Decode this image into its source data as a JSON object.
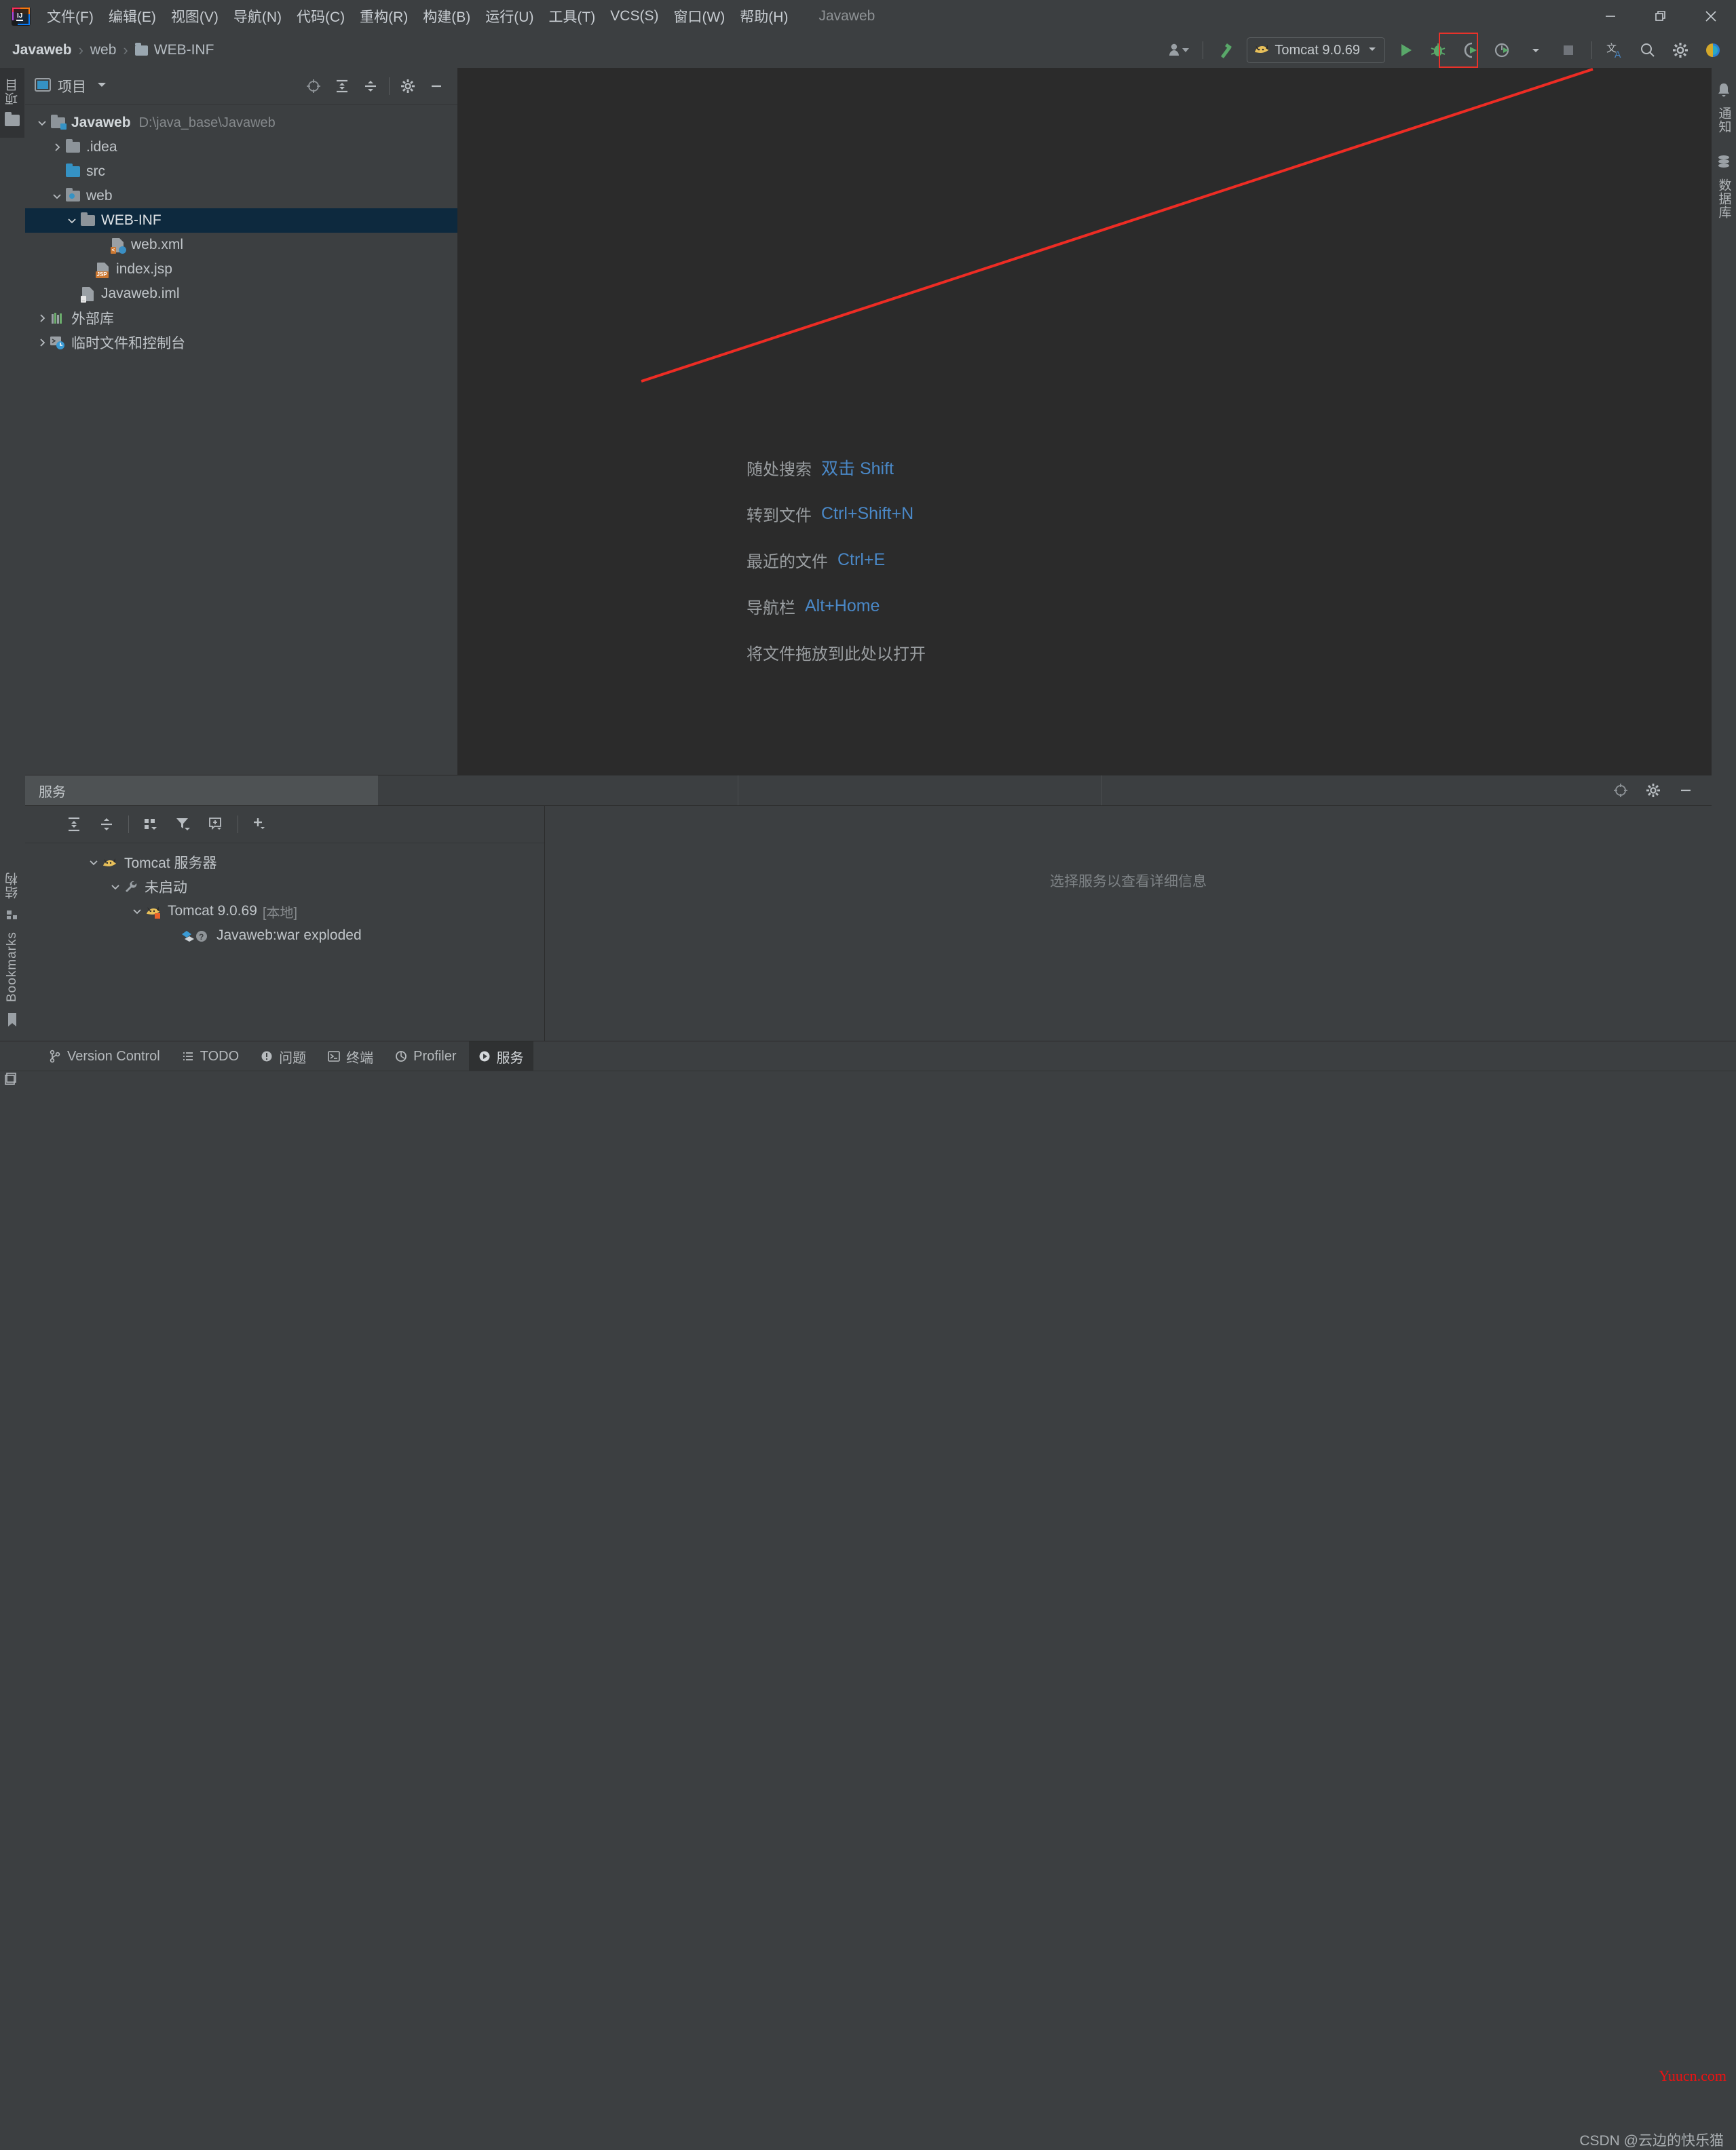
{
  "window": {
    "title": "Javaweb",
    "controls": {
      "minimize": "minimize-icon",
      "restore": "restore-icon",
      "close": "close-icon"
    }
  },
  "menubar": {
    "logo": "intellij-idea-logo",
    "items": [
      {
        "label": "文件(F)",
        "mnemonic": "F"
      },
      {
        "label": "编辑(E)",
        "mnemonic": "E"
      },
      {
        "label": "视图(V)",
        "mnemonic": "V"
      },
      {
        "label": "导航(N)",
        "mnemonic": "N"
      },
      {
        "label": "代码(C)",
        "mnemonic": "C"
      },
      {
        "label": "重构(R)",
        "mnemonic": "R"
      },
      {
        "label": "构建(B)",
        "mnemonic": "B"
      },
      {
        "label": "运行(U)",
        "mnemonic": "U"
      },
      {
        "label": "工具(T)",
        "mnemonic": "T"
      },
      {
        "label": "VCS(S)",
        "mnemonic": "S"
      },
      {
        "label": "窗口(W)",
        "mnemonic": "W"
      },
      {
        "label": "帮助(H)",
        "mnemonic": "H"
      }
    ]
  },
  "navbar": {
    "breadcrumbs": [
      {
        "label": "Javaweb",
        "icon": ""
      },
      {
        "label": "web",
        "icon": ""
      },
      {
        "label": "WEB-INF",
        "icon": "folder-icon"
      }
    ],
    "separator": "›",
    "run_config": {
      "label": "Tomcat 9.0.69",
      "icon": "tomcat-cat-icon",
      "dropdown": "chevron-down-icon"
    },
    "buttons": [
      "account-icon",
      "build-hammer-icon",
      "run-icon",
      "debug-icon",
      "run-with-coverage-icon",
      "profiler-icon",
      "stop-icon",
      "translate-icon",
      "search-everywhere-icon",
      "settings-gear-icon",
      "ide-feature-icon"
    ]
  },
  "left_stripe": {
    "top": [
      {
        "label": "项目",
        "icon": "project-icon"
      },
      {
        "label": "",
        "icon": "folder-stripe-icon"
      }
    ],
    "bottom": [
      {
        "label": "结构",
        "icon": "structure-icon"
      },
      {
        "label": "Bookmarks",
        "icon": "bookmark-icon"
      }
    ]
  },
  "right_stripe": {
    "items": [
      {
        "label": "通知",
        "icon": "notifications-bell-icon"
      },
      {
        "label": "数据库",
        "icon": "database-icon"
      }
    ]
  },
  "project_panel": {
    "title": "项目",
    "title_dropdown": "chevron-down-icon",
    "toolbar": [
      "locate-target-icon",
      "expand-all-icon",
      "collapse-all-icon",
      "settings-gear-icon",
      "hide-icon"
    ],
    "tree": [
      {
        "indent": 0,
        "twisty": "expanded",
        "icon": "module-folder-icon",
        "label": "Javaweb",
        "bold": true,
        "path": "D:\\java_base\\Javaweb",
        "selected": false
      },
      {
        "indent": 1,
        "twisty": "collapsed",
        "icon": "folder-icon",
        "label": ".idea",
        "bold": false,
        "path": "",
        "selected": false
      },
      {
        "indent": 1,
        "twisty": "none",
        "icon": "source-folder-icon",
        "label": "src",
        "bold": false,
        "path": "",
        "selected": false
      },
      {
        "indent": 1,
        "twisty": "expanded",
        "icon": "web-folder-icon",
        "label": "web",
        "bold": false,
        "path": "",
        "selected": false
      },
      {
        "indent": 2,
        "twisty": "expanded",
        "icon": "folder-icon",
        "label": "WEB-INF",
        "bold": false,
        "path": "",
        "selected": true
      },
      {
        "indent": 3,
        "twisty": "none",
        "icon": "xml-file-icon",
        "label": "web.xml",
        "bold": false,
        "path": "",
        "selected": false
      },
      {
        "indent": 2,
        "twisty": "none",
        "icon": "jsp-file-icon",
        "label": "index.jsp",
        "bold": false,
        "path": "",
        "selected": false
      },
      {
        "indent": 1,
        "twisty": "none",
        "icon": "iml-file-icon",
        "label": "Javaweb.iml",
        "bold": false,
        "path": "",
        "selected": false
      },
      {
        "indent": 0,
        "twisty": "collapsed",
        "icon": "external-libraries-icon",
        "label": "外部库",
        "bold": false,
        "path": "",
        "selected": false
      },
      {
        "indent": 0,
        "twisty": "collapsed",
        "icon": "scratches-consoles-icon",
        "label": "临时文件和控制台",
        "bold": false,
        "path": "",
        "selected": false
      }
    ]
  },
  "editor": {
    "hints": [
      {
        "label": "随处搜索",
        "key": "双击 Shift"
      },
      {
        "label": "转到文件",
        "key": "Ctrl+Shift+N"
      },
      {
        "label": "最近的文件",
        "key": "Ctrl+E"
      },
      {
        "label": "导航栏",
        "key": "Alt+Home"
      },
      {
        "label": "将文件拖放到此处以打开",
        "key": ""
      }
    ],
    "annotation": {
      "type": "red-arrow",
      "color": "#ee2c24"
    }
  },
  "services": {
    "tab_label": "服务",
    "tab_toolbar": [
      "locate-target-icon",
      "settings-gear-icon",
      "hide-icon"
    ],
    "toolbar": [
      "expand-all-icon",
      "collapse-all-icon",
      "group-by-icon",
      "filter-icon",
      "add-tab-icon",
      "add-icon"
    ],
    "tree": [
      {
        "indent": 0,
        "twisty": "expanded",
        "icon": "tomcat-cat-icon",
        "label": "Tomcat 服务器",
        "suffix": ""
      },
      {
        "indent": 1,
        "twisty": "expanded",
        "icon": "wrench-icon",
        "label": "未启动",
        "suffix": ""
      },
      {
        "indent": 2,
        "twisty": "expanded",
        "icon": "tomcat-cat-stopped-icon",
        "label": "Tomcat 9.0.69",
        "suffix": "[本地]"
      },
      {
        "indent": 3,
        "twisty": "none",
        "icon": "artifact-unknown-icon",
        "label": "Javaweb:war exploded",
        "suffix": ""
      }
    ],
    "detail_placeholder": "选择服务以查看详细信息"
  },
  "bottom_bar": {
    "items": [
      {
        "label": "Version Control",
        "icon": "branch-icon",
        "active": false
      },
      {
        "label": "TODO",
        "icon": "todo-list-icon",
        "active": false
      },
      {
        "label": "问题",
        "icon": "problems-icon",
        "active": false
      },
      {
        "label": "终端",
        "icon": "terminal-icon",
        "active": false
      },
      {
        "label": "Profiler",
        "icon": "profiler-icon",
        "active": false
      },
      {
        "label": "服务",
        "icon": "services-icon",
        "active": true
      }
    ]
  },
  "status_bar": {
    "left_icon": "layout-icon"
  },
  "watermarks": {
    "red": "Yuucn.com",
    "gray": "CSDN @云边的快乐猫"
  },
  "colors": {
    "accent_blue": "#4a88c7",
    "selection_blue": "#0d293e",
    "run_green": "#59a869",
    "annotation_red": "#ee2c24",
    "watermark_red": "#ee1111",
    "panel_bg": "#3c3f41",
    "editor_bg": "#2b2b2b"
  }
}
